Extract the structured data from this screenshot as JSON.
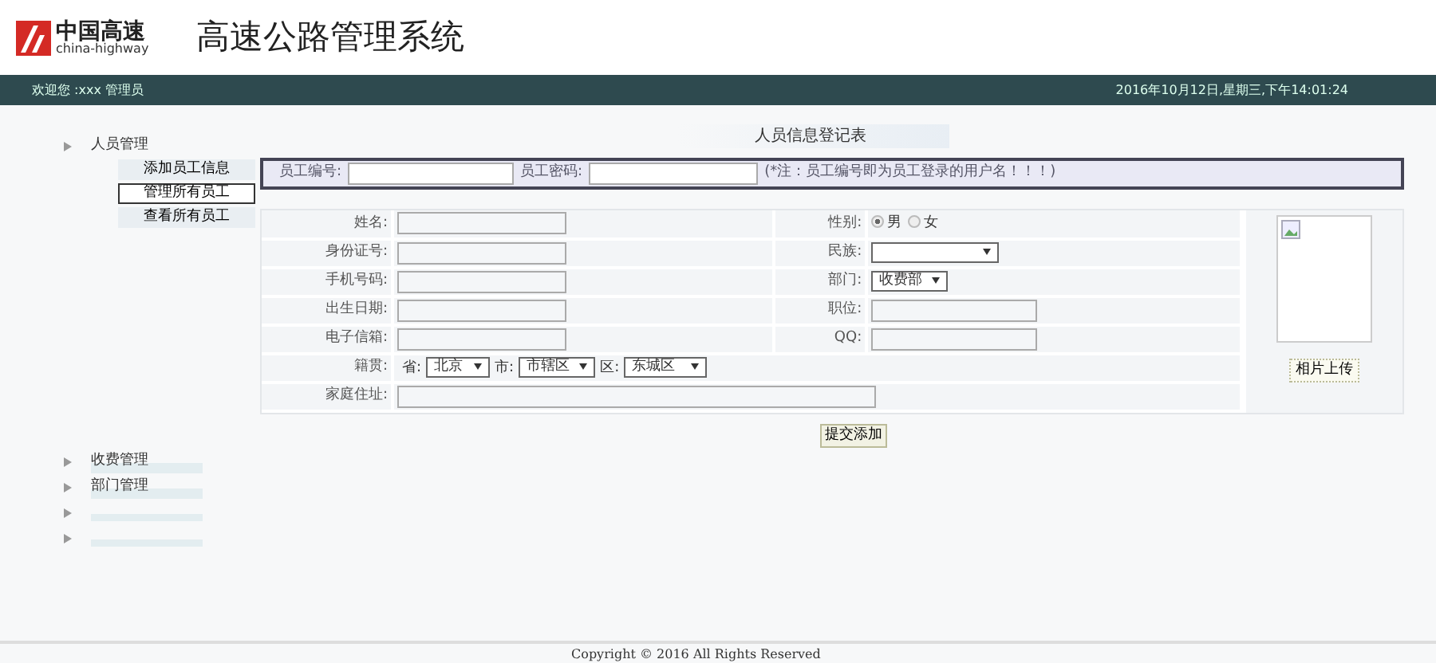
{
  "header": {
    "logo": {
      "cn": "中国高速",
      "en": "china-highway"
    },
    "title": "高速公路管理系统"
  },
  "topbar": {
    "welcome": "欢迎您 :xxx 管理员",
    "datetime": "2016年10月12日,星期三,下午14:01:24"
  },
  "sidebar": {
    "groups": [
      {
        "kind": "menu",
        "label": "人员管理",
        "items": [
          {
            "label": "添加员工信息",
            "selected": false
          },
          {
            "label": "管理所有员工",
            "selected": true
          },
          {
            "label": "查看所有员工",
            "selected": false
          }
        ]
      },
      {
        "kind": "menu",
        "label": "收费管理"
      },
      {
        "kind": "menu",
        "label": "部门管理"
      },
      {
        "kind": "blank"
      },
      {
        "kind": "blank"
      }
    ]
  },
  "form": {
    "title": "人员信息登记表",
    "account": {
      "fields": [
        {
          "label": "员工编号:"
        },
        {
          "label": "员工密码:"
        }
      ],
      "note": "(*注：员工编号即为员工登录的用户名！！！)"
    },
    "rows": [
      {
        "left": {
          "kind": "text",
          "label": "姓名:"
        },
        "right": {
          "kind": "radio",
          "label": "性别:",
          "options": [
            {
              "label": "男",
              "selected": true
            },
            {
              "label": "女",
              "selected": false
            }
          ]
        }
      },
      {
        "left": {
          "kind": "text",
          "label": "身份证号:"
        },
        "right": {
          "kind": "select",
          "label": "民族:"
        }
      },
      {
        "left": {
          "kind": "text",
          "label": "手机号码:"
        },
        "right": {
          "kind": "select",
          "label": "部门:",
          "value": "收费部"
        }
      },
      {
        "left": {
          "kind": "text",
          "label": "出生日期:"
        },
        "right": {
          "kind": "text",
          "label": "职位:"
        }
      },
      {
        "left": {
          "kind": "text",
          "label": "电子信箱:"
        },
        "right": {
          "kind": "text",
          "label": "QQ:"
        }
      },
      {
        "left": {
          "kind": "region",
          "label": "籍贯:",
          "selects": [
            {
              "prefix": "省:",
              "value": "北京"
            },
            {
              "prefix": "市:",
              "value": "市辖区"
            },
            {
              "prefix": "区:",
              "value": "东城区"
            }
          ]
        }
      },
      {
        "left": {
          "kind": "wide",
          "label": "家庭住址:"
        }
      }
    ],
    "photo": {
      "button": "相片上传"
    },
    "submit": "提交添加"
  },
  "footer": {
    "copyright": "Copyright © 2016 All Rights Reserved"
  }
}
